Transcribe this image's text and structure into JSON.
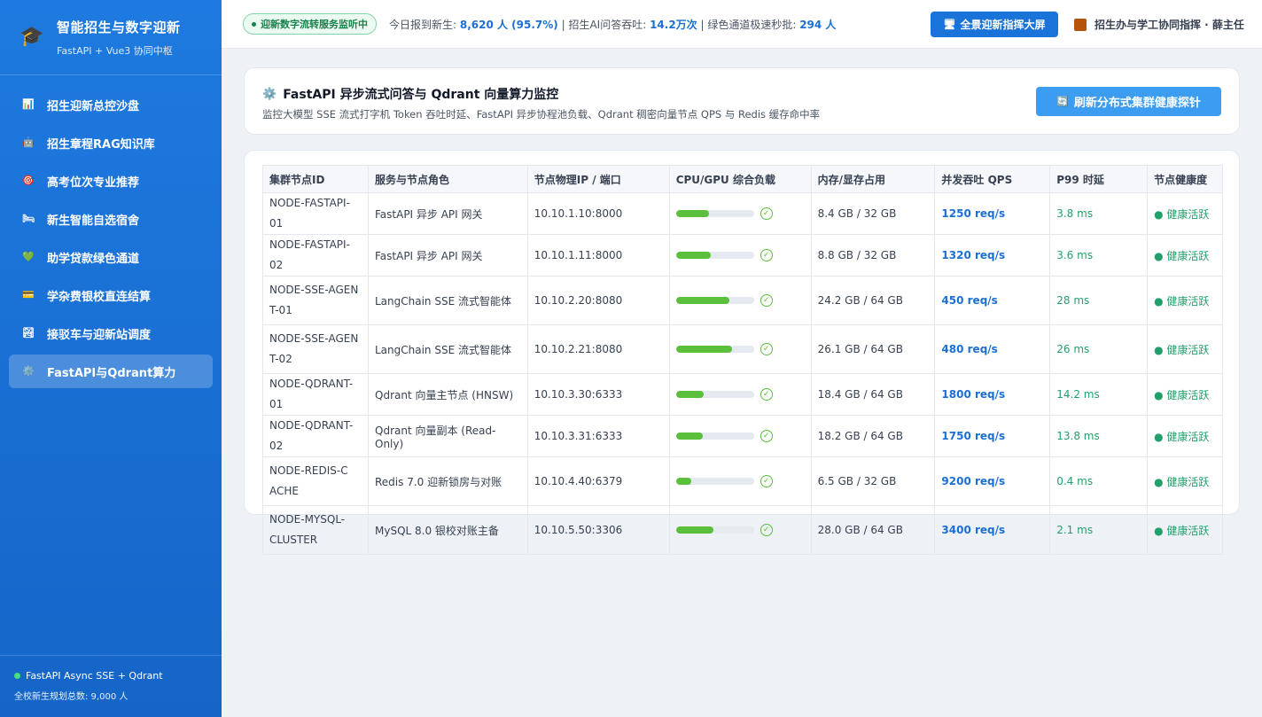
{
  "sidebar": {
    "brand_icon": "graduation-cap-icon",
    "brand_title": "智能招生与数字迎新",
    "brand_subtitle": "FastAPI + Vue3 协同中枢",
    "items": [
      {
        "icon": "bar-chart-icon",
        "label": "招生迎新总控沙盘",
        "active": false
      },
      {
        "icon": "robot-icon",
        "label": "招生章程RAG知识库",
        "active": false
      },
      {
        "icon": "target-icon",
        "label": "高考位次专业推荐",
        "active": false
      },
      {
        "icon": "bed-icon",
        "label": "新生智能自选宿舍",
        "active": false
      },
      {
        "icon": "heart-icon",
        "label": "助学贷款绿色通道",
        "active": false
      },
      {
        "icon": "card-icon",
        "label": "学杂费银校直连结算",
        "active": false
      },
      {
        "icon": "landscape-icon",
        "label": "接驳车与迎新站调度",
        "active": false
      },
      {
        "icon": "gear-icon",
        "label": "FastAPI与Qdrant算力",
        "active": true
      }
    ],
    "footer_status": "FastAPI Async SSE + Qdrant",
    "footer_total": "全校新生规划总数: 9,000 人"
  },
  "topbar": {
    "live_badge": "迎新数字流转服务监听中",
    "stat_prefix1": "今日报到新生: ",
    "stat_value1": "8,620 人 (95.7%)",
    "stat_prefix2": " | 招生AI问答吞吐: ",
    "stat_value2": "14.2万次",
    "stat_prefix3": " | 绿色通道极速秒批: ",
    "stat_value3": "294 人",
    "big_screen_button": "全景迎新指挥大屏",
    "user_label": "招生办与学工协同指挥 · 薛主任"
  },
  "header": {
    "title": "FastAPI 异步流式问答与 Qdrant 向量算力监控",
    "description": "监控大模型 SSE 流式打字机 Token 吞吐时延、FastAPI 异步协程池负载、Qdrant 稠密向量节点 QPS 与 Redis 缓存命中率",
    "refresh_button": "刷新分布式集群健康探针"
  },
  "table": {
    "columns": [
      "集群节点ID",
      "服务与节点角色",
      "节点物理IP / 端口",
      "CPU/GPU 综合负载",
      "内存/显存占用",
      "并发吞吐 QPS",
      "P99 时延",
      "节点健康度"
    ],
    "rows": [
      {
        "id": "NODE-FASTAPI-01",
        "role": "FastAPI 异步 API 网关",
        "ip": "10.10.1.10:8000",
        "load": 0.42,
        "mem": "8.4 GB / 32 GB",
        "qps": "1250 req/s",
        "p99": "3.8 ms",
        "health": "● 健康活跃"
      },
      {
        "id": "NODE-FASTAPI-02",
        "role": "FastAPI 异步 API 网关",
        "ip": "10.10.1.11:8000",
        "load": 0.45,
        "mem": "8.8 GB / 32 GB",
        "qps": "1320 req/s",
        "p99": "3.6 ms",
        "health": "● 健康活跃"
      },
      {
        "id": "NODE-SSE-AGENT-01",
        "role": "LangChain SSE 流式智能体",
        "ip": "10.10.2.20:8080",
        "load": 0.68,
        "mem": "24.2 GB / 64 GB",
        "qps": "450 req/s",
        "p99": "28 ms",
        "health": "● 健康活跃"
      },
      {
        "id": "NODE-SSE-AGENT-02",
        "role": "LangChain SSE 流式智能体",
        "ip": "10.10.2.21:8080",
        "load": 0.72,
        "mem": "26.1 GB / 64 GB",
        "qps": "480 req/s",
        "p99": "26 ms",
        "health": "● 健康活跃"
      },
      {
        "id": "NODE-QDRANT-01",
        "role": "Qdrant 向量主节点 (HNSW)",
        "ip": "10.10.3.30:6333",
        "load": 0.36,
        "mem": "18.4 GB / 64 GB",
        "qps": "1800 req/s",
        "p99": "14.2 ms",
        "health": "● 健康活跃"
      },
      {
        "id": "NODE-QDRANT-02",
        "role": "Qdrant 向量副本 (Read-Only)",
        "ip": "10.10.3.31:6333",
        "load": 0.34,
        "mem": "18.2 GB / 64 GB",
        "qps": "1750 req/s",
        "p99": "13.8 ms",
        "health": "● 健康活跃"
      },
      {
        "id": "NODE-REDIS-CACHE",
        "role": "Redis 7.0 迎新锁房与对账",
        "ip": "10.10.4.40:6379",
        "load": 0.2,
        "mem": "6.5 GB / 32 GB",
        "qps": "9200 req/s",
        "p99": "0.4 ms",
        "health": "● 健康活跃"
      },
      {
        "id": "NODE-MYSQL-CLUSTER",
        "role": "MySQL 8.0 银校对账主备",
        "ip": "10.10.5.50:3306",
        "load": 0.48,
        "mem": "28.0 GB / 64 GB",
        "qps": "3400 req/s",
        "p99": "2.1 ms",
        "health": "● 健康活跃"
      }
    ]
  },
  "colors": {
    "sidebar_bg": "#1e7ae0",
    "accent": "#1a73d9",
    "load_bar": "#5abf3a",
    "healthy": "#22a06b",
    "qps": "#1d6fd1"
  }
}
